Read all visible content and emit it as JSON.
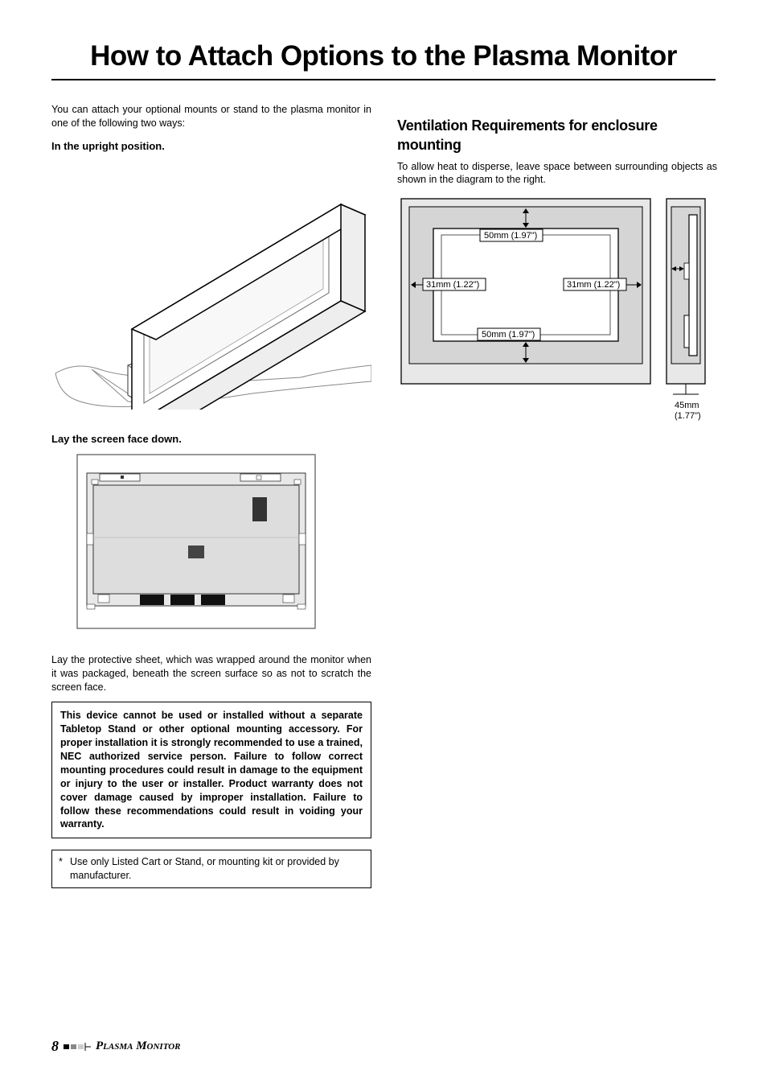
{
  "title": "How to Attach Options to the Plasma Monitor",
  "intro": "You can attach your optional mounts or stand to the plasma monitor in one of the following two ways:",
  "upright_heading": "In the upright position.",
  "facedown_heading": "Lay the screen face down.",
  "facedown_body": "Lay the protective sheet, which was wrapped around the monitor when it was packaged, beneath the screen surface so as not to scratch the screen face.",
  "warning": "This device cannot be used or installed without a separate Tabletop Stand or other optional mounting accessory.  For proper installation it is strongly recommended to use a trained, NEC authorized service person.  Failure to follow correct mounting procedures could result in damage to the equipment or injury to the user or installer.  Product warranty does not cover damage caused by improper installation.  Failure to follow these recommendations could result in voiding your warranty.",
  "note": "Use only Listed Cart or Stand, or mounting kit or provided by manufacturer.",
  "vent": {
    "title": "Ventilation Requirements for enclosure mounting",
    "body": "To allow heat to disperse, leave space between surrounding objects as shown in the diagram to the right.",
    "top": "50mm (1.97\")",
    "bottom": "50mm (1.97\")",
    "left": "31mm (1.22\")",
    "right": "31mm (1.22\")",
    "depth": "45mm",
    "depth2": "(1.77\")"
  },
  "footer": {
    "page": "8",
    "product": "Plasma Monitor"
  }
}
